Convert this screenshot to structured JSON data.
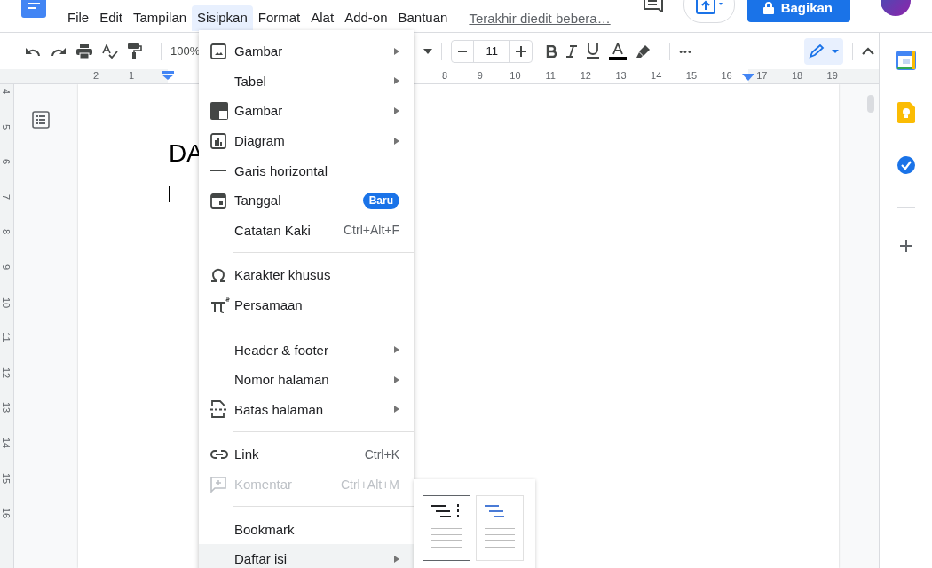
{
  "app_bar": {
    "menus": [
      {
        "label": "File",
        "selected": false
      },
      {
        "label": "Edit",
        "selected": false
      },
      {
        "label": "Tampilan",
        "selected": false
      },
      {
        "label": "Sisipkan",
        "selected": true
      },
      {
        "label": "Format",
        "selected": false
      },
      {
        "label": "Alat",
        "selected": false
      },
      {
        "label": "Add-on",
        "selected": false
      },
      {
        "label": "Bantuan",
        "selected": false
      }
    ],
    "last_edit": "Terakhir diedit bebera…",
    "share_button": "Bagikan"
  },
  "toolbar": {
    "zoom": "100%",
    "font_size": "11",
    "more": "•••"
  },
  "ruler": {
    "horizontal": [
      "2",
      "1",
      "8",
      "9",
      "10",
      "11",
      "12",
      "13",
      "14",
      "15",
      "16",
      "17",
      "18",
      "19"
    ],
    "vertical": [
      "4",
      "5",
      "6",
      "7",
      "8",
      "9",
      "10",
      "11",
      "12",
      "13",
      "14",
      "15",
      "16"
    ]
  },
  "document": {
    "heading": "DA"
  },
  "insert_menu": {
    "items": [
      {
        "kind": "item",
        "label": "Gambar",
        "submenu": true,
        "disabled": false,
        "highlighted": false
      },
      {
        "kind": "item",
        "label": "Tabel",
        "submenu": true,
        "disabled": false,
        "highlighted": false
      },
      {
        "kind": "item",
        "label": "Gambar",
        "submenu": true,
        "disabled": false,
        "highlighted": false
      },
      {
        "kind": "item",
        "label": "Diagram",
        "submenu": true,
        "disabled": false,
        "highlighted": false
      },
      {
        "kind": "item",
        "label": "Garis horizontal",
        "submenu": false,
        "disabled": false,
        "highlighted": false
      },
      {
        "kind": "item",
        "label": "Tanggal",
        "submenu": false,
        "badge": "Baru",
        "disabled": false,
        "highlighted": false
      },
      {
        "kind": "item",
        "label": "Catatan Kaki",
        "submenu": false,
        "shortcut": "Ctrl+Alt+F",
        "disabled": false,
        "highlighted": false
      },
      {
        "kind": "separator"
      },
      {
        "kind": "item",
        "label": "Karakter khusus",
        "submenu": false,
        "disabled": false,
        "highlighted": false
      },
      {
        "kind": "item",
        "label": "Persamaan",
        "submenu": false,
        "disabled": false,
        "highlighted": false
      },
      {
        "kind": "separator"
      },
      {
        "kind": "item",
        "label": "Header & footer",
        "submenu": true,
        "disabled": false,
        "highlighted": false
      },
      {
        "kind": "item",
        "label": "Nomor halaman",
        "submenu": true,
        "disabled": false,
        "highlighted": false
      },
      {
        "kind": "item",
        "label": "Batas halaman",
        "submenu": true,
        "disabled": false,
        "highlighted": false
      },
      {
        "kind": "separator"
      },
      {
        "kind": "item",
        "label": "Link",
        "submenu": false,
        "shortcut": "Ctrl+K",
        "disabled": false,
        "highlighted": false
      },
      {
        "kind": "item",
        "label": "Komentar",
        "submenu": false,
        "shortcut": "Ctrl+Alt+M",
        "disabled": true,
        "highlighted": false
      },
      {
        "kind": "separator"
      },
      {
        "kind": "item",
        "label": "Bookmark",
        "submenu": false,
        "disabled": false,
        "highlighted": false
      },
      {
        "kind": "item",
        "label": "Daftar isi",
        "submenu": true,
        "disabled": false,
        "highlighted": true
      }
    ]
  },
  "toc_submenu": {
    "options": [
      {
        "selected": true
      },
      {
        "selected": false
      }
    ]
  }
}
